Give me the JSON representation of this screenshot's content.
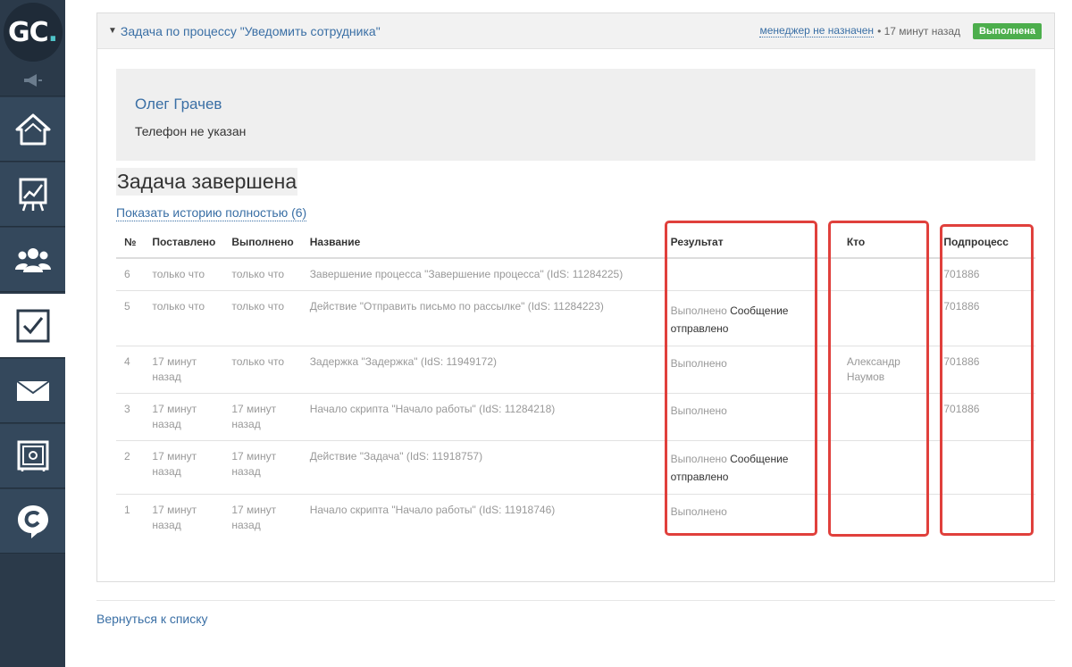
{
  "brand": {
    "logo_text": "GC",
    "logo_dot": "."
  },
  "sidebar": {
    "items": [
      {
        "name": "home-icon"
      },
      {
        "name": "chart-icon"
      },
      {
        "name": "users-icon"
      },
      {
        "name": "tasks-icon",
        "active": true
      },
      {
        "name": "mail-icon"
      },
      {
        "name": "safe-icon"
      },
      {
        "name": "chat-icon"
      }
    ]
  },
  "task": {
    "title": "Задача по процессу \"Уведомить сотрудника\"",
    "manager": "менеджер не назначен",
    "time": "• 17 минут назад",
    "status": "Выполнена"
  },
  "contact": {
    "name": "Олег Грачев",
    "phone": "Телефон не указан"
  },
  "done_title": "Задача завершена",
  "history_link": "Показать историю полностью (6)",
  "table": {
    "headers": {
      "num": "№",
      "set": "Поставлено",
      "done": "Выполнено",
      "name": "Название",
      "result": "Результат",
      "who": "Кто",
      "sub": "Подпроцесс"
    },
    "rows": [
      {
        "num": "6",
        "set": "только что",
        "done": "только что",
        "name": "Завершение процесса \"Завершение процесса\" (IdS: 11284225)",
        "result_status": "",
        "result_msg": "",
        "who": "",
        "sub": "701886"
      },
      {
        "num": "5",
        "set": "только что",
        "done": "только что",
        "name": "Действие \"Отправить письмо по рассылке\" (IdS: 11284223)",
        "result_status": "Выполнено",
        "result_msg": "Сообщение отправлено",
        "who": "",
        "sub": "701886"
      },
      {
        "num": "4",
        "set": "17 минут назад",
        "done": "только что",
        "name": "Задержка \"Задержка\" (IdS: 11949172)",
        "result_status": "Выполнено",
        "result_msg": "",
        "who": "Александр Наумов",
        "sub": "701886"
      },
      {
        "num": "3",
        "set": "17 минут назад",
        "done": "17 минут назад",
        "name": "Начало скрипта \"Начало работы\" (IdS: 11284218)",
        "result_status": "Выполнено",
        "result_msg": "",
        "who": "",
        "sub": "701886"
      },
      {
        "num": "2",
        "set": "17 минут назад",
        "done": "17 минут назад",
        "name": "Действие \"Задача\" (IdS: 11918757)",
        "result_status": "Выполнено",
        "result_msg": "Сообщение отправлено",
        "who": "",
        "sub": ""
      },
      {
        "num": "1",
        "set": "17 минут назад",
        "done": "17 минут назад",
        "name": "Начало скрипта \"Начало работы\" (IdS: 11918746)",
        "result_status": "Выполнено",
        "result_msg": "",
        "who": "",
        "sub": ""
      }
    ]
  },
  "back_link": "Вернуться к списку",
  "colors": {
    "accent": "#3a6fa5",
    "sidebar": "#2b3a4a",
    "success": "#4cae4c",
    "highlight": "#e0403c"
  }
}
